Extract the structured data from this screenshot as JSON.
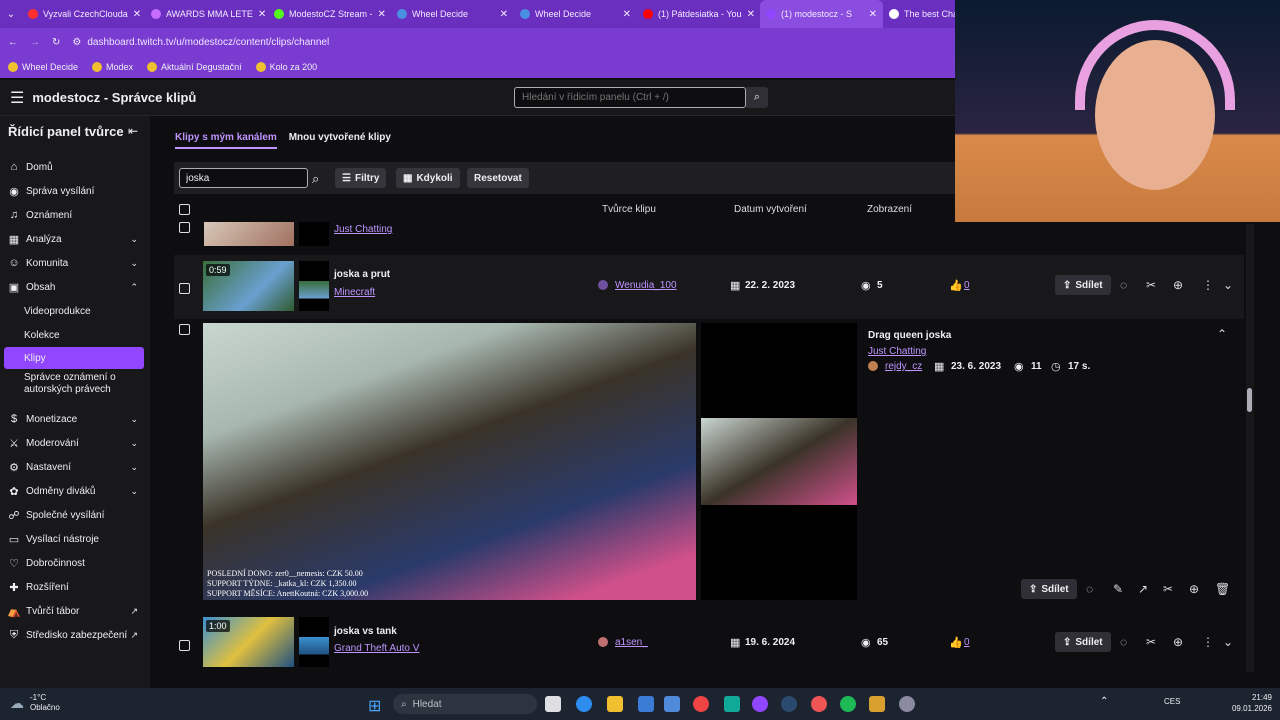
{
  "browser": {
    "tabs": [
      {
        "label": "Vyzvali CzechClouda",
        "color": "#ff3030"
      },
      {
        "label": "AWARDS MMA LETE",
        "color": "#c86cff"
      },
      {
        "label": "ModestoCZ Stream -",
        "color": "#53fc18"
      },
      {
        "label": "Wheel Decide",
        "color": "#4a90e2"
      },
      {
        "label": "Wheel Decide",
        "color": "#4a90e2"
      },
      {
        "label": "(1) Pátdesiatka - You",
        "color": "#ff0000"
      },
      {
        "label": "(1) modestocz - S",
        "color": "#9147ff"
      },
      {
        "label": "The best Cha",
        "color": "#ffffff"
      }
    ],
    "url": "dashboard.twitch.tv/u/modestocz/content/clips/channel",
    "bookmarks": [
      "Wheel Decide",
      "Modex",
      "Aktuální Degustační",
      "Kolo za 200"
    ]
  },
  "header": {
    "title": "modestocz - Správce klipů",
    "search_placeholder": "Hledání v řídicím panelu (Ctrl + /)"
  },
  "sidebar": {
    "title": "Řídicí panel tvůrce",
    "items": [
      {
        "label": "Domů",
        "icon": "home-icon",
        "glyph": "⌂",
        "chev": ""
      },
      {
        "label": "Správa vysílání",
        "icon": "broadcast-icon",
        "glyph": "◉",
        "chev": ""
      },
      {
        "label": "Oznámení",
        "icon": "bell-icon",
        "glyph": "♫",
        "chev": ""
      },
      {
        "label": "Analýza",
        "icon": "chart-icon",
        "glyph": "▦",
        "chev": "⌄"
      },
      {
        "label": "Komunita",
        "icon": "community-icon",
        "glyph": "☺",
        "chev": "⌄"
      },
      {
        "label": "Obsah",
        "icon": "content-icon",
        "glyph": "▣",
        "chev": "⌃"
      },
      {
        "label": "Videoprodukce",
        "icon": "",
        "glyph": "",
        "chev": ""
      },
      {
        "label": "Kolekce",
        "icon": "",
        "glyph": "",
        "chev": ""
      },
      {
        "label": "Klipy",
        "icon": "",
        "glyph": "",
        "chev": ""
      },
      {
        "label": "Správce oznámení o autorských právech",
        "icon": "",
        "glyph": "",
        "chev": ""
      },
      {
        "label": "Monetizace",
        "icon": "money-icon",
        "glyph": "$",
        "chev": "⌄"
      },
      {
        "label": "Moderování",
        "icon": "sword-icon",
        "glyph": "⚔",
        "chev": "⌄"
      },
      {
        "label": "Nastavení",
        "icon": "gear-icon",
        "glyph": "⚙",
        "chev": "⌄"
      },
      {
        "label": "Odměny diváků",
        "icon": "gift-icon",
        "glyph": "✿",
        "chev": "⌄"
      },
      {
        "label": "Společné vysílání",
        "icon": "people-icon",
        "glyph": "☍",
        "chev": ""
      },
      {
        "label": "Vysílací nástroje",
        "icon": "tools-icon",
        "glyph": "▭",
        "chev": ""
      },
      {
        "label": "Dobročinnost",
        "icon": "charity-icon",
        "glyph": "♡",
        "chev": ""
      },
      {
        "label": "Rozšíření",
        "icon": "extension-icon",
        "glyph": "✚",
        "chev": ""
      },
      {
        "label": "Tvůrčí tábor",
        "icon": "camp-icon",
        "glyph": "⛺",
        "chev": "↗"
      },
      {
        "label": "Středisko zabezpečení",
        "icon": "shield-icon",
        "glyph": "⛨",
        "chev": "↗"
      }
    ]
  },
  "content": {
    "tabs": [
      "Klipy s mým kanálem",
      "Mnou vytvořené klipy"
    ],
    "filter_value": "joska",
    "buttons": {
      "filters": "Filtry",
      "time": "Kdykoli",
      "reset": "Resetovat"
    },
    "columns": {
      "creator": "Tvůrce klipu",
      "date": "Datum vytvoření",
      "views": "Zobrazení"
    },
    "partial_row": {
      "category": "Just Chatting"
    },
    "rows": [
      {
        "duration": "0:59",
        "title": "joska a prut",
        "category": "Minecraft",
        "creator": "Wenudia_100",
        "date": "22. 2. 2023",
        "views": "5",
        "likes": "0",
        "share": "Sdílet"
      },
      {
        "duration": "1:00",
        "title": "joska vs tank",
        "category": "Grand Theft Auto V",
        "creator": "a1sen_",
        "date": "19. 6. 2024",
        "views": "65",
        "likes": "0",
        "share": "Sdílet"
      }
    ],
    "expanded": {
      "title": "Drag queen joska",
      "category": "Just Chatting",
      "creator": "rejdy_cz",
      "date": "23. 6. 2023",
      "views": "11",
      "length": "17 s.",
      "share": "Sdílet",
      "overlay": [
        "POSLEDNÍ DONO: zer0__nemesis: CZK 50.00",
        "SUPPORT TÝDNE: _katka_kl: CZK 1,350.00",
        "SUPPORT MĚSÍCE: AnettKoutná: CZK 3,000.00"
      ]
    }
  },
  "taskbar": {
    "weather_temp": "-1°C",
    "weather_desc": "Oblačno",
    "search": "Hledat",
    "lang": "CES",
    "time": "21:49",
    "date": "09.01.2026"
  }
}
